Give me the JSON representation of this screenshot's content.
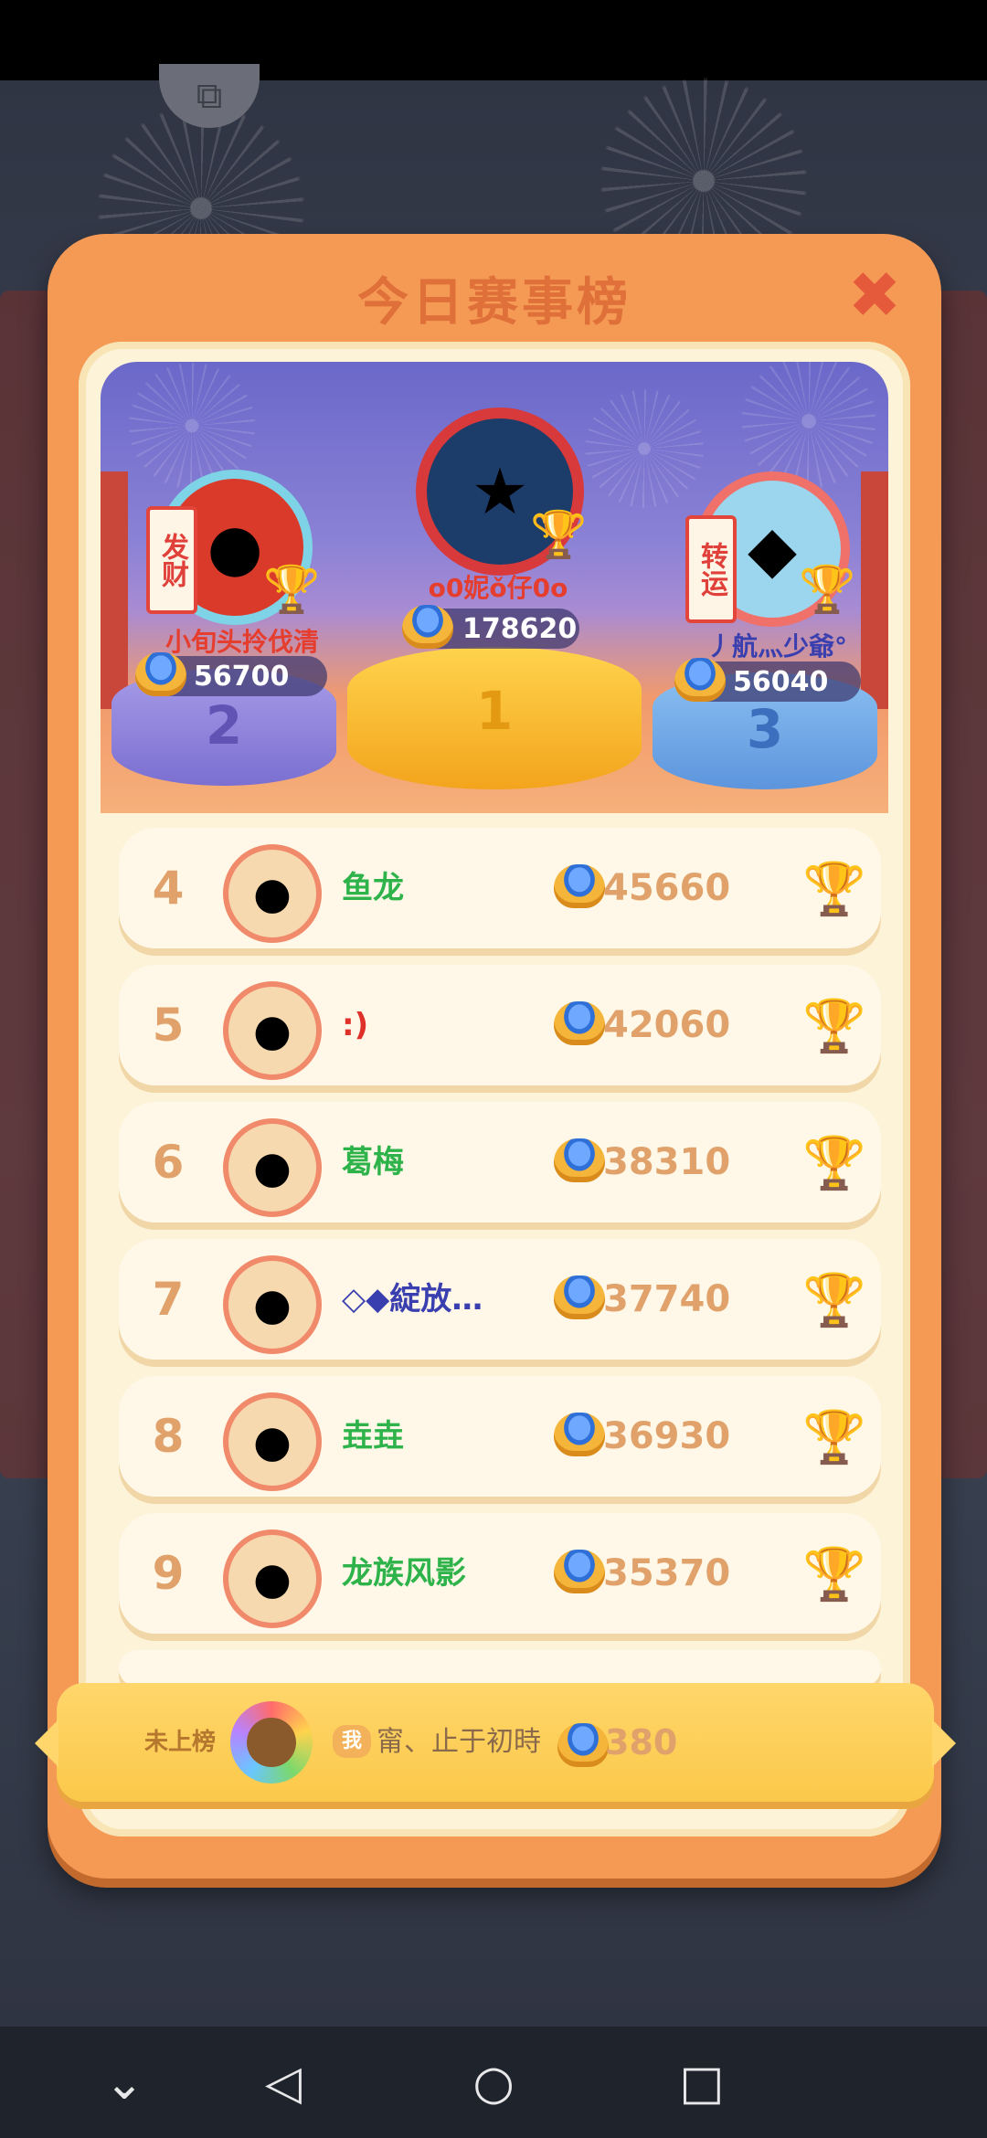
{
  "board": {
    "title": "今日赛事榜",
    "close_symbol": "✖"
  },
  "podium": {
    "first": {
      "rank": "1",
      "name": "o0妮ǒ仔0o",
      "score": "178620"
    },
    "second": {
      "rank": "2",
      "name": "小旬头拎伐清",
      "score": "56700",
      "banner": "发财"
    },
    "third": {
      "rank": "3",
      "name": "丿航灬少爺°",
      "score": "56040",
      "banner": "转运"
    }
  },
  "rows": [
    {
      "rank": "4",
      "name": "鱼龙",
      "score": "45660",
      "name_color": "#2db34a"
    },
    {
      "rank": "5",
      "name": ":)",
      "score": "42060",
      "name_color": "#e0302a"
    },
    {
      "rank": "6",
      "name": "葛梅",
      "score": "38310",
      "name_color": "#2db34a"
    },
    {
      "rank": "7",
      "name": "◇◆綻放…",
      "score": "37740",
      "name_color": "#3a3fb0"
    },
    {
      "rank": "8",
      "name": "垚垚",
      "score": "36930",
      "name_color": "#2db34a"
    },
    {
      "rank": "9",
      "name": "龙族风影",
      "score": "35370",
      "name_color": "#2db34a"
    }
  ],
  "self": {
    "status": "未上榜",
    "badge": "我",
    "name": "甯、止于初時",
    "score": "380"
  },
  "nav": {
    "collapse_symbol": "⌄",
    "back_symbol": "◁",
    "home_symbol": "○",
    "recents_symbol": "□"
  }
}
